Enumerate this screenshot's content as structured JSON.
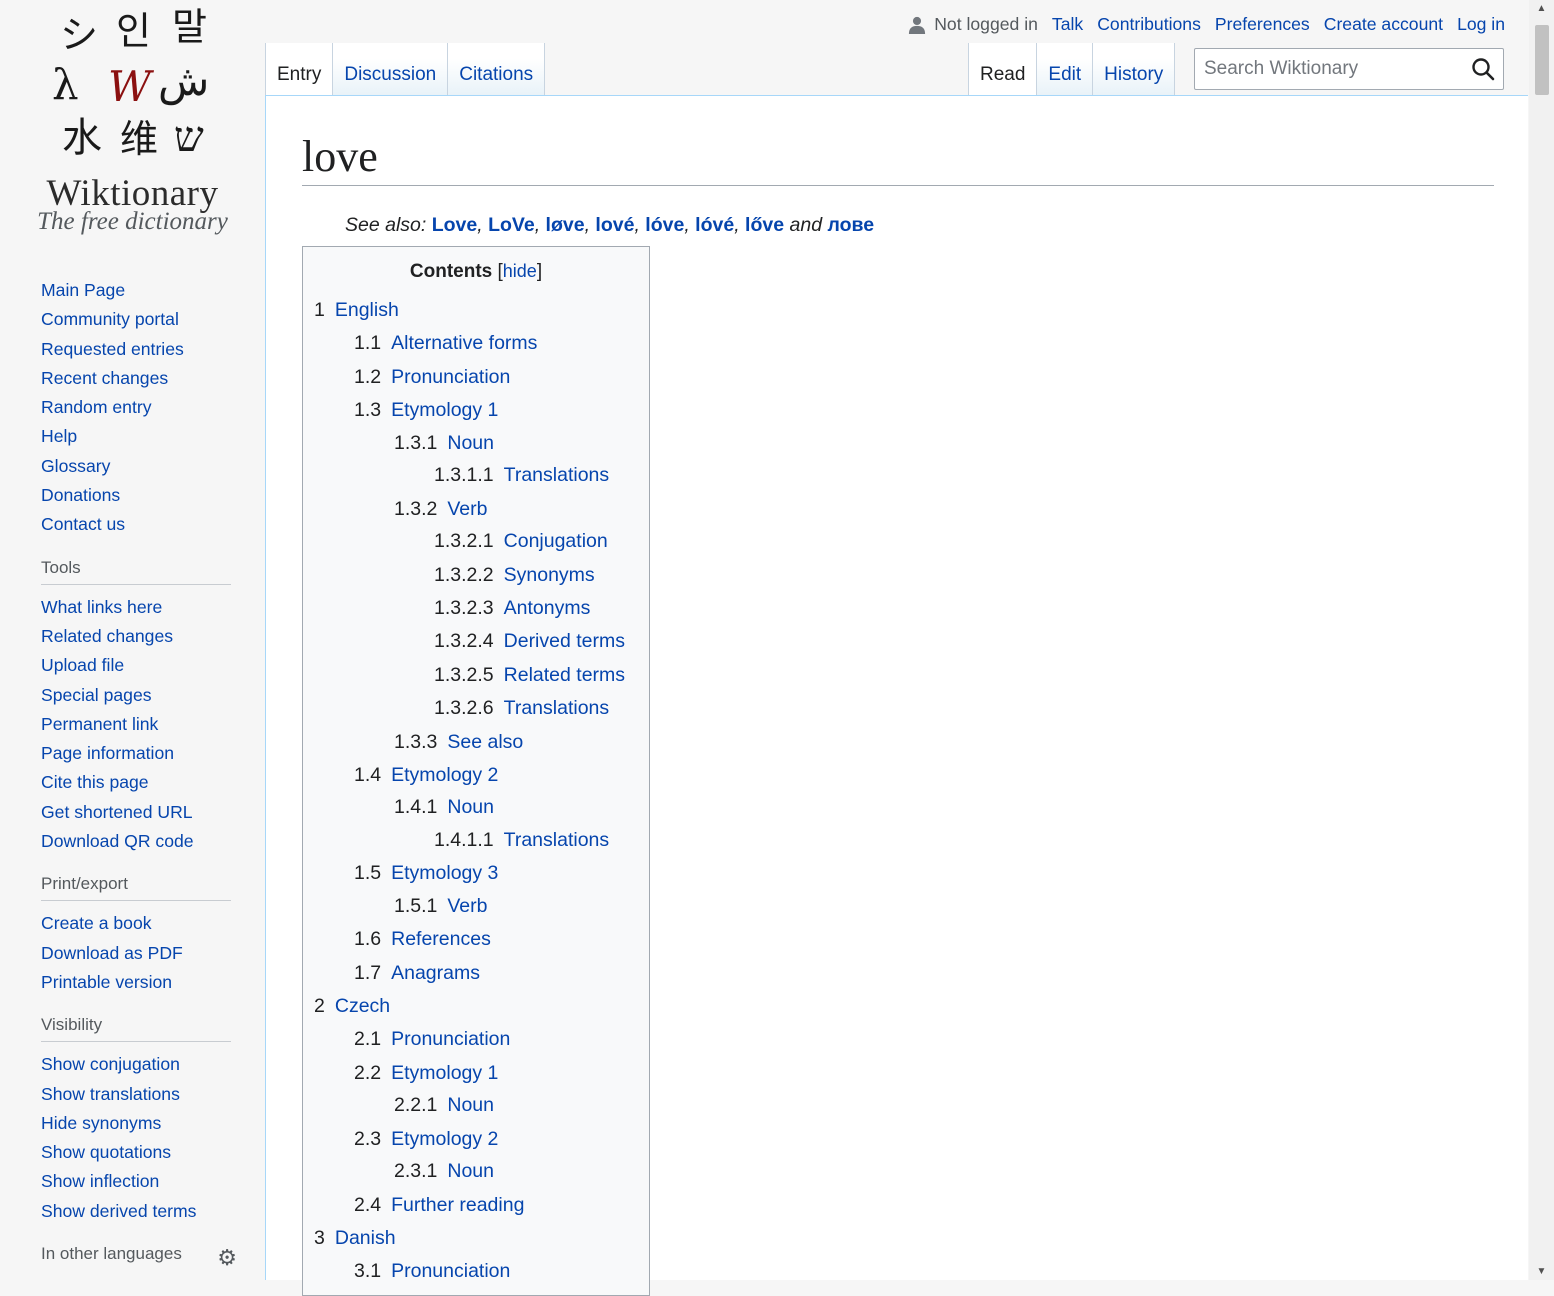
{
  "logo": {
    "glyphs": [
      "シ",
      "인",
      "말",
      "λ",
      "W",
      "ش",
      "水",
      "维",
      "ש"
    ],
    "wordmark": "Wiktionary",
    "tagline": "The free dictionary"
  },
  "sidebar": {
    "navigation": [
      "Main Page",
      "Community portal",
      "Requested entries",
      "Recent changes",
      "Random entry",
      "Help",
      "Glossary",
      "Donations",
      "Contact us"
    ],
    "tools": {
      "heading": "Tools",
      "items": [
        "What links here",
        "Related changes",
        "Upload file",
        "Special pages",
        "Permanent link",
        "Page information",
        "Cite this page",
        "Get shortened URL",
        "Download QR code"
      ]
    },
    "print": {
      "heading": "Print/export",
      "items": [
        "Create a book",
        "Download as PDF",
        "Printable version"
      ]
    },
    "visibility": {
      "heading": "Visibility",
      "items": [
        "Show conjugation",
        "Show translations",
        "Hide synonyms",
        "Show quotations",
        "Show inflection",
        "Show derived terms"
      ]
    },
    "languages": {
      "heading": "In other languages"
    }
  },
  "personal": {
    "not_logged_in": "Not logged in",
    "talk": "Talk",
    "contributions": "Contributions",
    "preferences": "Preferences",
    "create_account": "Create account",
    "log_in": "Log in"
  },
  "tabs": {
    "left": [
      "Entry",
      "Discussion",
      "Citations"
    ],
    "right": [
      "Read",
      "Edit",
      "History"
    ]
  },
  "search": {
    "placeholder": "Search Wiktionary"
  },
  "page": {
    "title": "love",
    "see_also_label": "See also:",
    "see_also": [
      "Love",
      "LoVe",
      "løve",
      "lové",
      "lóve",
      "lóvé",
      "lőve"
    ],
    "see_also_and": "and",
    "see_also_last": "лове"
  },
  "toc": {
    "title": "Contents",
    "hide": "hide",
    "items": [
      {
        "num": "1",
        "text": "English",
        "level": 1
      },
      {
        "num": "1.1",
        "text": "Alternative forms",
        "level": 2
      },
      {
        "num": "1.2",
        "text": "Pronunciation",
        "level": 2
      },
      {
        "num": "1.3",
        "text": "Etymology 1",
        "level": 2
      },
      {
        "num": "1.3.1",
        "text": "Noun",
        "level": 3
      },
      {
        "num": "1.3.1.1",
        "text": "Translations",
        "level": 4
      },
      {
        "num": "1.3.2",
        "text": "Verb",
        "level": 3
      },
      {
        "num": "1.3.2.1",
        "text": "Conjugation",
        "level": 4
      },
      {
        "num": "1.3.2.2",
        "text": "Synonyms",
        "level": 4
      },
      {
        "num": "1.3.2.3",
        "text": "Antonyms",
        "level": 4
      },
      {
        "num": "1.3.2.4",
        "text": "Derived terms",
        "level": 4
      },
      {
        "num": "1.3.2.5",
        "text": "Related terms",
        "level": 4
      },
      {
        "num": "1.3.2.6",
        "text": "Translations",
        "level": 4
      },
      {
        "num": "1.3.3",
        "text": "See also",
        "level": 3
      },
      {
        "num": "1.4",
        "text": "Etymology 2",
        "level": 2
      },
      {
        "num": "1.4.1",
        "text": "Noun",
        "level": 3
      },
      {
        "num": "1.4.1.1",
        "text": "Translations",
        "level": 4
      },
      {
        "num": "1.5",
        "text": "Etymology 3",
        "level": 2
      },
      {
        "num": "1.5.1",
        "text": "Verb",
        "level": 3
      },
      {
        "num": "1.6",
        "text": "References",
        "level": 2
      },
      {
        "num": "1.7",
        "text": "Anagrams",
        "level": 2
      },
      {
        "num": "2",
        "text": "Czech",
        "level": 1
      },
      {
        "num": "2.1",
        "text": "Pronunciation",
        "level": 2
      },
      {
        "num": "2.2",
        "text": "Etymology 1",
        "level": 2
      },
      {
        "num": "2.2.1",
        "text": "Noun",
        "level": 3
      },
      {
        "num": "2.3",
        "text": "Etymology 2",
        "level": 2
      },
      {
        "num": "2.3.1",
        "text": "Noun",
        "level": 3
      },
      {
        "num": "2.4",
        "text": "Further reading",
        "level": 2
      },
      {
        "num": "3",
        "text": "Danish",
        "level": 1
      },
      {
        "num": "3.1",
        "text": "Pronunciation",
        "level": 2
      }
    ]
  }
}
